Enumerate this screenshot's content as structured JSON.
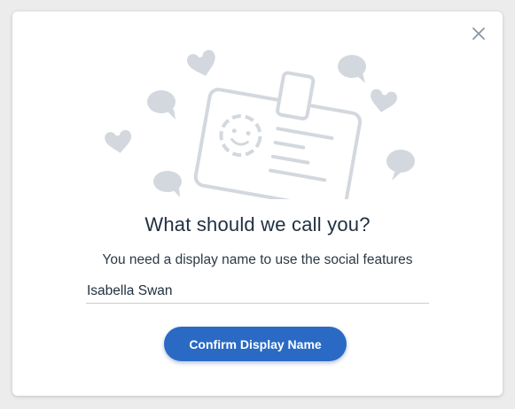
{
  "dialog": {
    "title": "What should we call you?",
    "subtitle": "You need a display name to use the social features",
    "name_input": {
      "value": "Isabella Swan",
      "placeholder": ""
    },
    "confirm_label": "Confirm Display Name",
    "close_icon": "close-icon"
  },
  "colors": {
    "accent": "#2a6ac4",
    "illustration": "#d3d8de",
    "title": "#1f2f3f"
  }
}
